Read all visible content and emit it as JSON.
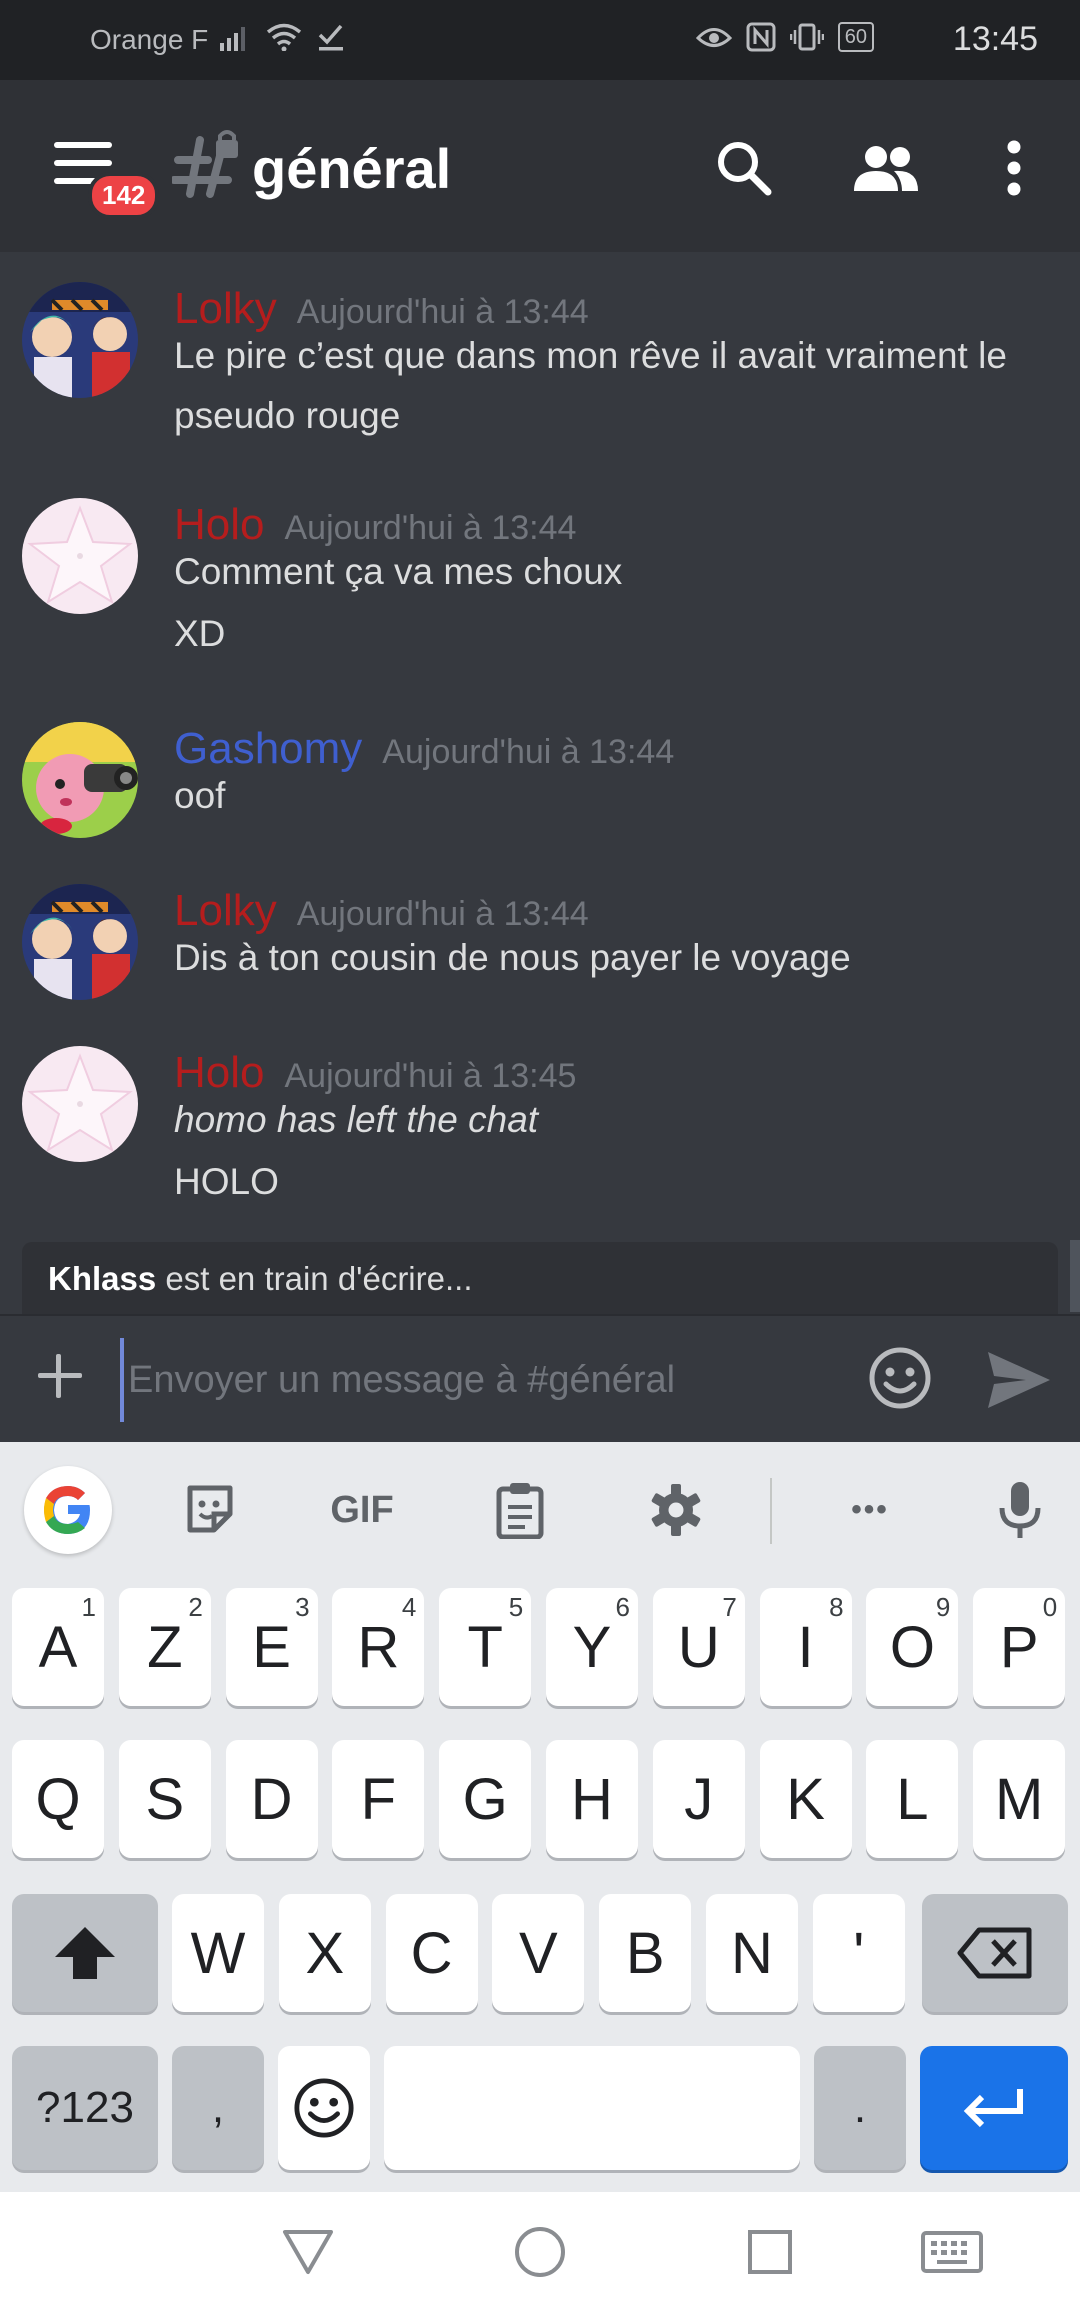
{
  "status_bar": {
    "carrier": "Orange F",
    "battery": "60",
    "time": "13:45"
  },
  "header": {
    "badge_count": "142",
    "channel_name": "général"
  },
  "messages": [
    {
      "author": "Lolky",
      "author_color": "#b51d1d",
      "time": "Aujourd'hui à 13:44",
      "lines": [
        "Le pire c’est que dans mon rêve il avait vraiment le",
        "pseudo rouge"
      ],
      "avatar": "lolky"
    },
    {
      "author": "Holo",
      "author_color": "#b51d1d",
      "time": "Aujourd'hui à 13:44",
      "lines": [
        "Comment ça va mes choux",
        "XD"
      ],
      "avatar": "holo"
    },
    {
      "author": "Gashomy",
      "author_color": "#3f5fcf",
      "time": "Aujourd'hui à 13:44",
      "lines": [
        "oof"
      ],
      "avatar": "gashomy"
    },
    {
      "author": "Lolky",
      "author_color": "#b51d1d",
      "time": "Aujourd'hui à 13:44",
      "lines": [
        "Dis à ton cousin de nous payer le voyage"
      ],
      "avatar": "lolky"
    },
    {
      "author": "Holo",
      "author_color": "#b51d1d",
      "time": "Aujourd'hui à 13:45",
      "lines": [
        "homo has left the chat",
        "HOLO"
      ],
      "italic_line": 0,
      "avatar": "holo"
    }
  ],
  "typing": {
    "user": "Khlass",
    "text": " est en train d'écrire..."
  },
  "composer": {
    "placeholder": "Envoyer un message à #général"
  },
  "keyboard": {
    "toolbar": {
      "gif_label": "GIF",
      "more_label": "•••"
    },
    "row1": [
      {
        "k": "A",
        "s": "1"
      },
      {
        "k": "Z",
        "s": "2"
      },
      {
        "k": "E",
        "s": "3"
      },
      {
        "k": "R",
        "s": "4"
      },
      {
        "k": "T",
        "s": "5"
      },
      {
        "k": "Y",
        "s": "6"
      },
      {
        "k": "U",
        "s": "7"
      },
      {
        "k": "I",
        "s": "8"
      },
      {
        "k": "O",
        "s": "9"
      },
      {
        "k": "P",
        "s": "0"
      }
    ],
    "row2": [
      "Q",
      "S",
      "D",
      "F",
      "G",
      "H",
      "J",
      "K",
      "L",
      "M"
    ],
    "row3": [
      "W",
      "X",
      "C",
      "V",
      "B",
      "N",
      "'"
    ],
    "symbols_label": "?123",
    "comma_label": ",",
    "period_label": "."
  },
  "colors": {
    "background": "#36393f",
    "header": "#2f3136",
    "status_bar": "#202225",
    "keyboard": "#e8eaed",
    "enter_key": "#1a73e8"
  },
  "icons": {
    "header": [
      "menu-icon",
      "hashtag-lock-icon",
      "search-icon",
      "members-icon",
      "more-vertical-icon"
    ],
    "composer": [
      "plus-icon",
      "emoji-icon",
      "send-icon"
    ],
    "keyboard_toolbar": [
      "google-icon",
      "sticker-icon",
      "gif-icon",
      "clipboard-icon",
      "settings-icon",
      "more-icon",
      "microphone-icon"
    ],
    "navbar": [
      "back-icon",
      "home-icon",
      "recents-icon",
      "keyboard-icon"
    ]
  }
}
